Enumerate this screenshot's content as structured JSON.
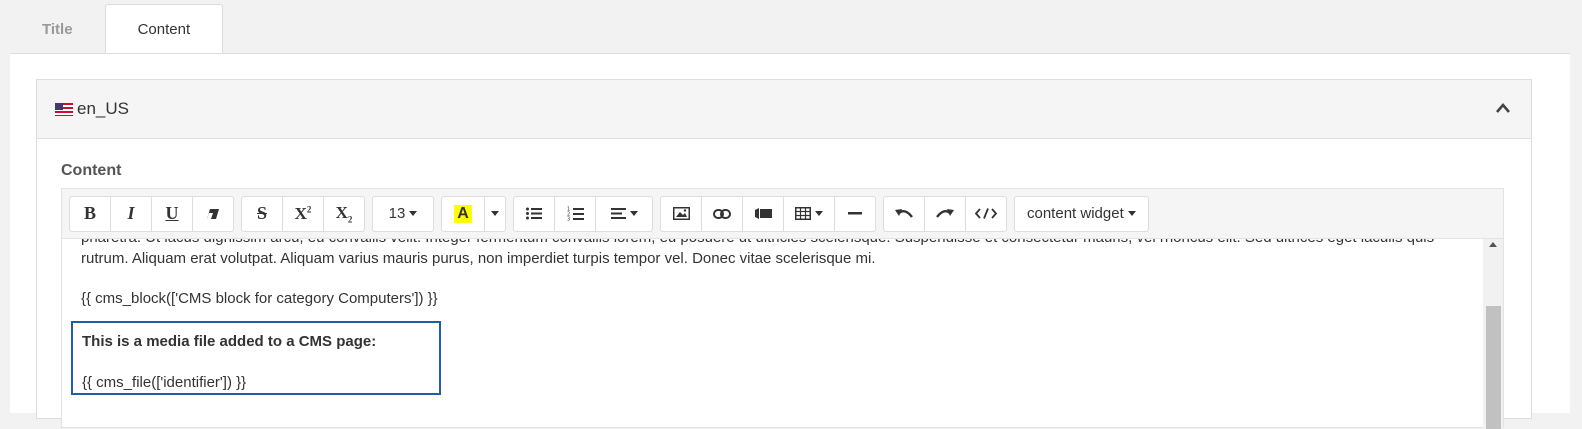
{
  "tabs": [
    {
      "label": "Title"
    },
    {
      "label": "Content"
    }
  ],
  "locale": {
    "label": "en_US",
    "flag": "us-flag-icon"
  },
  "field": {
    "label": "Content"
  },
  "toolbar": {
    "font_size": "13",
    "widget_label": "content widget",
    "buttons": [
      "bold-icon",
      "italic-icon",
      "underline-icon",
      "eraser-icon",
      "strikethrough-icon",
      "superscript-icon",
      "subscript-icon",
      "font-size-select",
      "text-color-icon",
      "color-dropdown",
      "unordered-list-icon",
      "ordered-list-icon",
      "align-icon",
      "image-icon",
      "link-icon",
      "video-icon",
      "table-icon",
      "horizontal-rule-icon",
      "undo-icon",
      "redo-icon",
      "code-view-icon",
      "content-widget-dropdown"
    ]
  },
  "content": {
    "paragraph1": "pharetra. Ut lacus dignissim arcu, eu convallis velit. Integer fermentum convallis lorem, eu posuere ut ultricies scelerisque. Suspendisse et consectetur mauris, vel rhoncus elit. Sed ultrices eget iaculis quis rutrum. Aliquam erat volutpat. Aliquam varius mauris purus, non imperdiet turpis tempor vel. Donec vitae scelerisque mi.",
    "cms_block": "{{ cms_block(['CMS block for category Computers']) }}",
    "media_title": "This is a media file added to a CMS page:",
    "cms_file": "{{ cms_file(['identifier']) }}"
  },
  "colors": {
    "accent_border": "#1f5fa9",
    "highlight": "#ffff00"
  }
}
